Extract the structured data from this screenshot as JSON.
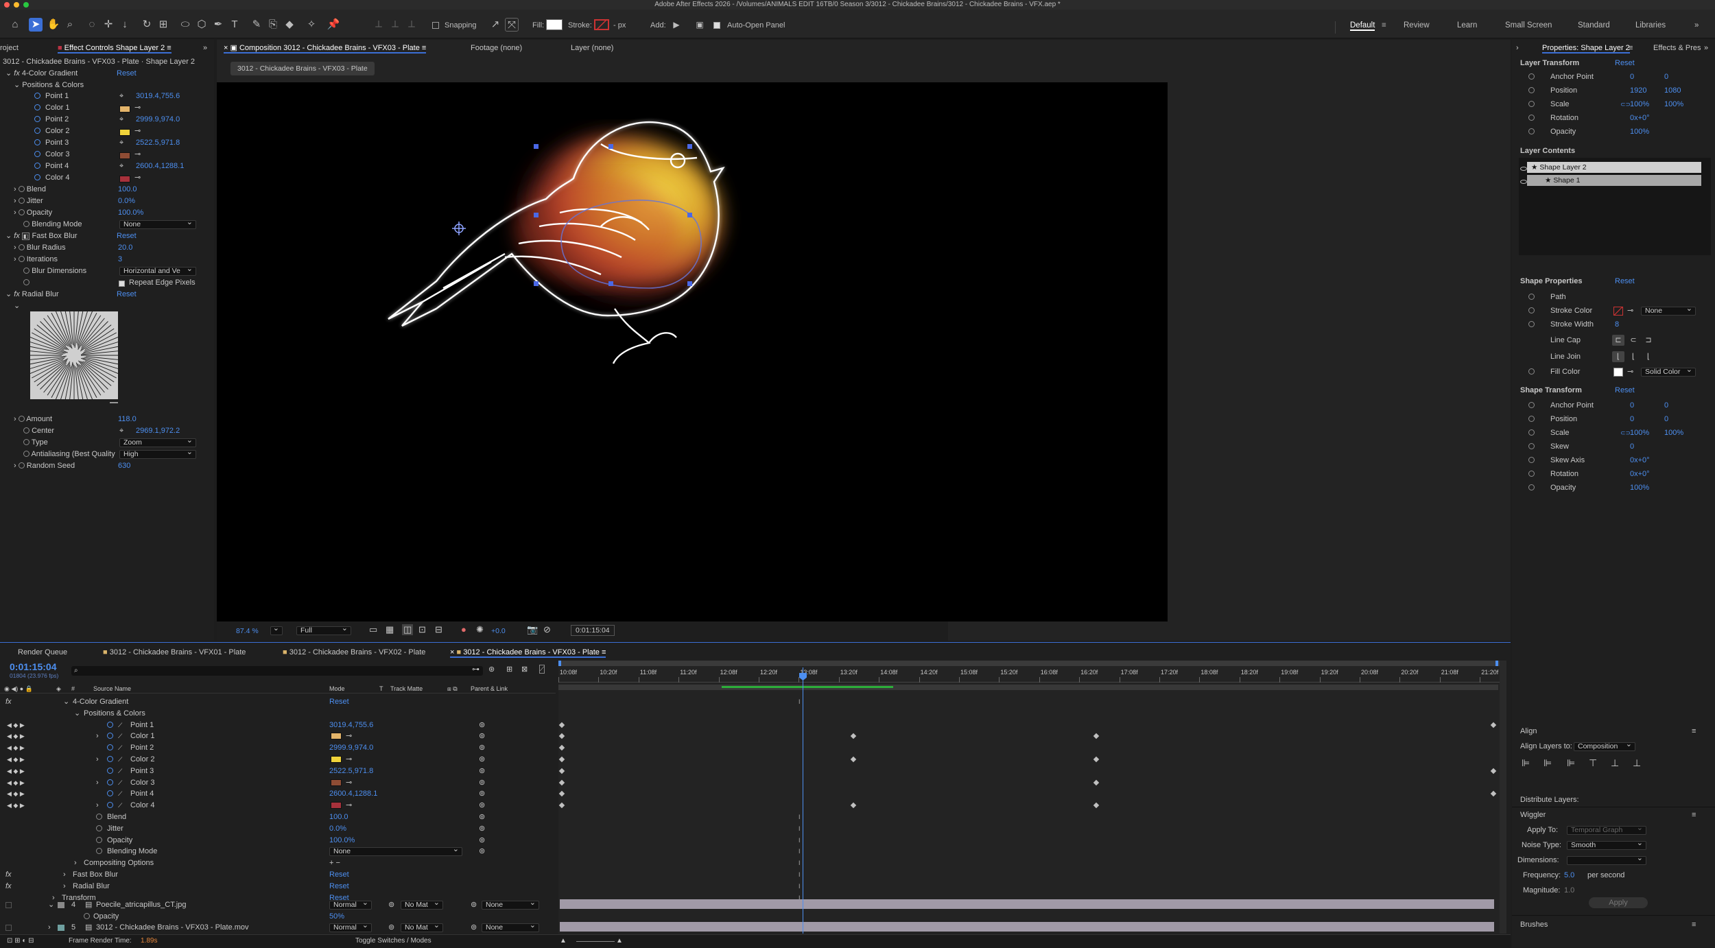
{
  "app": {
    "title": "Adobe After Effects 2026 - /Volumes/ANIMALS EDIT 16TB/0 Season 3/3012 - Chickadee Brains/3012 - Chickadee Brains - VFX.aep *"
  },
  "toolbar": {
    "snapping": "Snapping",
    "fill": "Fill:",
    "stroke": "Stroke:",
    "stroke_px": "- px",
    "add": "Add:",
    "auto_open": "Auto-Open Panel"
  },
  "workspaces": [
    "Default",
    "Review",
    "Learn",
    "Small Screen",
    "Standard",
    "Libraries"
  ],
  "left": {
    "tab_project": "roject",
    "tab_effect": "Effect Controls Shape Layer 2",
    "breadcrumb": "3012 - Chickadee Brains - VFX03 - Plate · Shape Layer 2",
    "effect1": {
      "name": "4-Color Gradient",
      "reset": "Reset",
      "group": "Positions & Colors",
      "point1_label": "Point 1",
      "point1": "3019.4,755.6",
      "color1_label": "Color 1",
      "color1": "#e3b46a",
      "point2_label": "Point 2",
      "point2": "2999.9,974.0",
      "color2_label": "Color 2",
      "color2": "#f0d33a",
      "point3_label": "Point 3",
      "point3": "2522.5,971.8",
      "color3_label": "Color 3",
      "color3": "#8e4c34",
      "point4_label": "Point 4",
      "point4": "2600.4,1288.1",
      "color4_label": "Color 4",
      "color4": "#a7313b",
      "blend_label": "Blend",
      "blend": "100.0",
      "jitter_label": "Jitter",
      "jitter": "0.0%",
      "opacity_label": "Opacity",
      "opacity": "100.0%",
      "blending_label": "Blending Mode",
      "blending": "None"
    },
    "effect2": {
      "name": "Fast Box Blur",
      "reset": "Reset",
      "radius_label": "Blur Radius",
      "radius": "20.0",
      "iter_label": "Iterations",
      "iter": "3",
      "dim_label": "Blur Dimensions",
      "dim": "Horizontal and Ve",
      "repeat": "Repeat Edge Pixels"
    },
    "effect3": {
      "name": "Radial Blur",
      "reset": "Reset",
      "amount_label": "Amount",
      "amount": "118.0",
      "center_label": "Center",
      "center": "2969.1,972.2",
      "type_label": "Type",
      "type": "Zoom",
      "aa_label": "Antialiasing (Best Quality",
      "aa": "High",
      "seed_label": "Random Seed",
      "seed": "630"
    }
  },
  "viewer": {
    "tab_comp": "Composition 3012 - Chickadee Brains - VFX03 - Plate",
    "tab_footage": "Footage (none)",
    "tab_layer": "Layer (none)",
    "breadcrumb": "3012 - Chickadee Brains - VFX03 - Plate",
    "zoom": "87.4 %",
    "resolution": "Full",
    "exposure": "+0.0",
    "timecode": "0:01:15:04"
  },
  "right": {
    "tab_props": "Properties: Shape Layer 2",
    "tab_effects": "Effects & Pres",
    "layer_transform": "Layer Transform",
    "reset": "Reset",
    "lt": [
      {
        "label": "Anchor Point",
        "v1": "0",
        "v2": "0"
      },
      {
        "label": "Position",
        "v1": "1920",
        "v2": "1080"
      },
      {
        "label": "Scale",
        "v1": "100%",
        "v2": "100%"
      },
      {
        "label": "Rotation",
        "v1": "0x+0°",
        "v2": ""
      },
      {
        "label": "Opacity",
        "v1": "100%",
        "v2": ""
      }
    ],
    "layer_contents": "Layer Contents",
    "shape_layer": "Shape Layer 2",
    "shape1": "Shape 1",
    "shape_props": "Shape Properties",
    "path": "Path",
    "stroke_color": "Stroke Color",
    "stroke_none": "None",
    "stroke_width": "Stroke Width",
    "stroke_width_val": "8",
    "line_cap": "Line Cap",
    "line_join": "Line Join",
    "fill_color": "Fill Color",
    "fill_type": "Solid Color",
    "shape_transform": "Shape Transform",
    "st": [
      {
        "label": "Anchor Point",
        "v1": "0",
        "v2": "0"
      },
      {
        "label": "Position",
        "v1": "0",
        "v2": "0"
      },
      {
        "label": "Scale",
        "v1": "100%",
        "v2": "100%"
      },
      {
        "label": "Skew",
        "v1": "0",
        "v2": ""
      },
      {
        "label": "Skew Axis",
        "v1": "0x+0°",
        "v2": ""
      },
      {
        "label": "Rotation",
        "v1": "0x+0°",
        "v2": ""
      },
      {
        "label": "Opacity",
        "v1": "100%",
        "v2": ""
      }
    ],
    "align": "Align",
    "align_to": "Align Layers to:",
    "align_to_val": "Composition",
    "distribute": "Distribute Layers:",
    "wiggler": "Wiggler",
    "apply_to": "Apply To:",
    "apply_to_val": "Temporal Graph",
    "noise": "Noise Type:",
    "noise_val": "Smooth",
    "dims": "Dimensions:",
    "freq": "Frequency:",
    "freq_val": "5.0",
    "per_second": "per second",
    "mag": "Magnitude:",
    "mag_val": "1.0",
    "apply": "Apply",
    "brushes": "Brushes"
  },
  "timeline": {
    "tabs": [
      "Render Queue",
      "3012 - Chickadee Brains - VFX01 - Plate",
      "3012 - Chickadee Brains - VFX02 - Plate",
      "3012 - Chickadee Brains - VFX03 - Plate"
    ],
    "timecode": "0:01:15:04",
    "frames": "01804 (23.976 fps)",
    "col_source": "Source Name",
    "col_mode": "Mode",
    "col_t": "T",
    "col_track": "Track Matte",
    "col_parent": "Parent & Link",
    "ruler": [
      "10:08f",
      "10:20f",
      "11:08f",
      "11:20f",
      "12:08f",
      "12:20f",
      "13:08f",
      "13:20f",
      "14:08f",
      "14:20f",
      "15:08f",
      "15:20f",
      "16:08f",
      "16:20f",
      "17:08f",
      "17:20f",
      "18:08f",
      "18:20f",
      "19:08f",
      "19:20f",
      "20:08f",
      "20:20f",
      "21:08f",
      "21:20f"
    ],
    "rows": [
      {
        "indent": 0,
        "name": "4-Color Gradient",
        "val": "Reset",
        "fx": true
      },
      {
        "indent": 1,
        "name": "Positions & Colors",
        "val": ""
      },
      {
        "indent": 2,
        "name": "Point 1",
        "val": "3019.4,755.6"
      },
      {
        "indent": 2,
        "name": "Color 1",
        "val": "",
        "swatch": "#e3b46a"
      },
      {
        "indent": 2,
        "name": "Point 2",
        "val": "2999.9,974.0"
      },
      {
        "indent": 2,
        "name": "Color 2",
        "val": "",
        "swatch": "#f0d33a"
      },
      {
        "indent": 2,
        "name": "Point 3",
        "val": "2522.5,971.8"
      },
      {
        "indent": 2,
        "name": "Color 3",
        "val": "",
        "swatch": "#8e4c34"
      },
      {
        "indent": 2,
        "name": "Point 4",
        "val": "2600.4,1288.1"
      },
      {
        "indent": 2,
        "name": "Color 4",
        "val": "",
        "swatch": "#a7313b"
      },
      {
        "indent": 1,
        "name": "Blend",
        "val": "100.0"
      },
      {
        "indent": 1,
        "name": "Jitter",
        "val": "0.0%"
      },
      {
        "indent": 1,
        "name": "Opacity",
        "val": "100.0%"
      },
      {
        "indent": 1,
        "name": "Blending Mode",
        "val": "None"
      },
      {
        "indent": 1,
        "name": "Compositing Options",
        "val": "+ −"
      },
      {
        "indent": 0,
        "name": "Fast Box Blur",
        "val": "Reset",
        "fx": true
      },
      {
        "indent": 0,
        "name": "Radial Blur",
        "val": "Reset",
        "fx": true
      },
      {
        "indent": -1,
        "name": "Transform",
        "val": "Reset"
      }
    ],
    "layer4": {
      "num": "4",
      "name": "Poecile_atricapillus_CT.jpg",
      "mode": "Normal",
      "matte": "No Mat",
      "parent": "None"
    },
    "opacity_label": "Opacity",
    "opacity_val": "50%",
    "layer5": {
      "num": "5",
      "name": "3012 - Chickadee Brains - VFX03 - Plate.mov",
      "mode": "Normal",
      "matte": "No Mat",
      "parent": "None"
    },
    "frame_render": "Frame Render Time:",
    "frame_render_val": "1.89s",
    "toggle": "Toggle Switches / Modes"
  }
}
